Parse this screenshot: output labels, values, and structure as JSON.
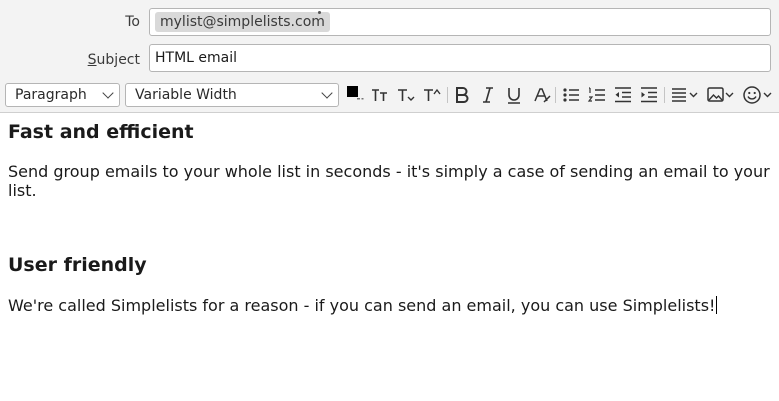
{
  "compose": {
    "to_label": "To",
    "to_recipient": "mylist@simplelists.com",
    "subject_label_underlined": "S",
    "subject_label_rest": "ubject",
    "subject_value": "HTML email"
  },
  "toolbar": {
    "paragraph_format": "Paragraph",
    "font_family": "Variable Width",
    "text_color": "#000000",
    "buttons": [
      "text-color-icon",
      "smaller-text-icon",
      "larger-text-icon",
      "superscript-font-icon",
      "bold-icon",
      "italic-icon",
      "underline-icon",
      "remove-formatting-icon",
      "bulleted-list-icon",
      "numbered-list-icon",
      "outdent-icon",
      "indent-icon",
      "align-icon",
      "insert-image-icon",
      "emoji-icon"
    ]
  },
  "body": {
    "heading1": "Fast and efficient",
    "paragraph1_line1": "Send group emails to your whole list in seconds - it's simply a case of sending an email to your",
    "paragraph1_line2": "list.",
    "heading2": "User friendly",
    "paragraph2": "We're called Simplelists for a reason - if you can send an email, you can use Simplelists!"
  }
}
